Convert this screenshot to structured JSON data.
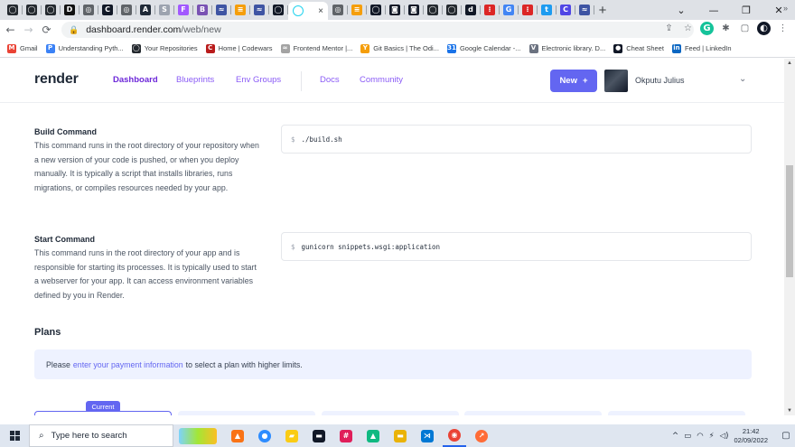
{
  "browser": {
    "tabs": [
      {
        "icon": "github-icon",
        "glyph": "◯",
        "color": "#24292f"
      },
      {
        "icon": "github-icon",
        "glyph": "◯",
        "color": "#24292f"
      },
      {
        "icon": "github-icon",
        "glyph": "◯",
        "color": "#24292f"
      },
      {
        "icon": "dev-icon",
        "glyph": "D",
        "color": "#111111"
      },
      {
        "icon": "chrome-icon",
        "glyph": "◎",
        "color": "#5f6368"
      },
      {
        "icon": "codewars-icon",
        "glyph": "C",
        "color": "#111827"
      },
      {
        "icon": "chrome-icon",
        "glyph": "◎",
        "color": "#5f6368"
      },
      {
        "icon": "vscode-dark-icon",
        "glyph": "A",
        "color": "#1f2937"
      },
      {
        "icon": "sketch-icon",
        "glyph": "S",
        "color": "#9ca3af"
      },
      {
        "icon": "figma-icon",
        "glyph": "F",
        "color": "#a259ff"
      },
      {
        "icon": "bootstrap-icon",
        "glyph": "B",
        "color": "#7952b3"
      },
      {
        "icon": "frontend-mentor-icon",
        "glyph": "≈",
        "color": "#3e54a3"
      },
      {
        "icon": "w3-icon",
        "glyph": "≡",
        "color": "#f59e0b"
      },
      {
        "icon": "frontend-mentor-icon",
        "glyph": "≈",
        "color": "#3e54a3"
      },
      {
        "icon": "render-icon",
        "glyph": "◯",
        "color": "#111827"
      }
    ],
    "active_tab": {
      "icon": "render-icon",
      "close": "×"
    },
    "tabs_after": [
      {
        "icon": "chrome-icon",
        "glyph": "◎",
        "color": "#5f6368"
      },
      {
        "icon": "w3-icon",
        "glyph": "≡",
        "color": "#f59e0b"
      },
      {
        "icon": "render-icon",
        "glyph": "◯",
        "color": "#111827"
      },
      {
        "icon": "dark-square-icon",
        "glyph": "◙",
        "color": "#111827"
      },
      {
        "icon": "dark-square-icon",
        "glyph": "◙",
        "color": "#111827"
      },
      {
        "icon": "github-icon",
        "glyph": "◯",
        "color": "#24292f"
      },
      {
        "icon": "github-icon",
        "glyph": "◯",
        "color": "#24292f"
      },
      {
        "icon": "stack-icon",
        "glyph": "d",
        "color": "#111827"
      },
      {
        "icon": "traffic-icon",
        "glyph": "⁝",
        "color": "#dc2626"
      },
      {
        "icon": "google-icon",
        "glyph": "G",
        "color": "#4285f4"
      },
      {
        "icon": "traffic-icon",
        "glyph": "⁝",
        "color": "#dc2626"
      },
      {
        "icon": "twitter-icon",
        "glyph": "t",
        "color": "#1d9bf0"
      },
      {
        "icon": "circle-c-icon",
        "glyph": "C",
        "color": "#4f46e5"
      },
      {
        "icon": "frontend-mentor-icon",
        "glyph": "≈",
        "color": "#3e54a3"
      }
    ],
    "new_tab": "+",
    "window_controls": [
      "⌄",
      "—",
      "❐",
      "✕"
    ],
    "back": "←",
    "forward": "→",
    "reload": "⟳",
    "lock": "🔒",
    "url_host": "dashboard.render.com",
    "url_path": "/web/new",
    "toolbar_icons": [
      "⇪",
      "☆",
      "G",
      "✱",
      "▢",
      "◐",
      "⋮"
    ],
    "bookmarks": [
      {
        "label": "Gmail",
        "glyph": "M",
        "color": "#ea4335"
      },
      {
        "label": "Understanding Pyth...",
        "glyph": "P",
        "color": "#3b82f6"
      },
      {
        "label": "Your Repositories",
        "glyph": "◯",
        "color": "#24292f"
      },
      {
        "label": "Home | Codewars",
        "glyph": "C",
        "color": "#b91c1c"
      },
      {
        "label": "Frontend Mentor |...",
        "glyph": "≈",
        "color": "#a3a3a3"
      },
      {
        "label": "Git Basics | The Odi...",
        "glyph": "Y",
        "color": "#f59e0b"
      },
      {
        "label": "Google Calendar -...",
        "glyph": "31",
        "color": "#1a73e8"
      },
      {
        "label": "Electronic library. D...",
        "glyph": "V",
        "color": "#6b7280"
      },
      {
        "label": "Cheat Sheet",
        "glyph": "●",
        "color": "#111827"
      },
      {
        "label": "Feed | LinkedIn",
        "glyph": "in",
        "color": "#0a66c2"
      }
    ],
    "bookmarks_more": "»"
  },
  "app": {
    "logo": "render",
    "nav": {
      "dashboard": "Dashboard",
      "blueprints": "Blueprints",
      "env_groups": "Env Groups",
      "docs": "Docs",
      "community": "Community"
    },
    "new_button": "New",
    "new_button_icon": "+",
    "user_name": "Okputu Julius",
    "user_chevron": "⌄"
  },
  "form": {
    "build": {
      "title": "Build Command",
      "description": "This command runs in the root directory of your repository when a new version of your code is pushed, or when you deploy manually. It is typically a script that installs libraries, runs migrations, or compiles resources needed by your app.",
      "prompt": "$",
      "value": "./build.sh"
    },
    "start": {
      "title": "Start Command",
      "description": "This command runs in the root directory of your app and is responsible for starting its processes. It is typically used to start a webserver for your app. It can access environment variables defined by you in Render.",
      "prompt": "$",
      "value": "gunicorn snippets.wsgi:application"
    }
  },
  "plans": {
    "title": "Plans",
    "notice_before": "Please",
    "notice_link": "enter your payment information",
    "notice_after": "to select a plan with higher limits.",
    "current_badge": "Current"
  },
  "taskbar": {
    "search_placeholder": "Type here to search",
    "apps": [
      {
        "icon": "vlc-icon",
        "glyph": "▲",
        "color": "#f97316"
      },
      {
        "icon": "zoom-icon",
        "glyph": "●",
        "color": "#2d8cff"
      },
      {
        "icon": "sticky-notes-icon",
        "glyph": "▰",
        "color": "#facc15"
      },
      {
        "icon": "terminal-icon",
        "glyph": "▬",
        "color": "#111827"
      },
      {
        "icon": "slack-icon",
        "glyph": "#",
        "color": "#e01e5a"
      },
      {
        "icon": "drive-icon",
        "glyph": "▲",
        "color": "#10b981"
      },
      {
        "icon": "file-explorer-icon",
        "glyph": "▬",
        "color": "#eab308"
      },
      {
        "icon": "vscode-icon",
        "glyph": "⋊",
        "color": "#0078d4"
      },
      {
        "icon": "chrome-icon",
        "glyph": "◉",
        "color": "#ea4335"
      },
      {
        "icon": "postman-icon",
        "glyph": "↗",
        "color": "#ff6c37"
      }
    ],
    "tray_icons": [
      "^",
      "▭",
      "◠",
      "⚡",
      "◁)"
    ],
    "time": "21:42",
    "date": "02/09/2022",
    "notifications": "▢"
  }
}
